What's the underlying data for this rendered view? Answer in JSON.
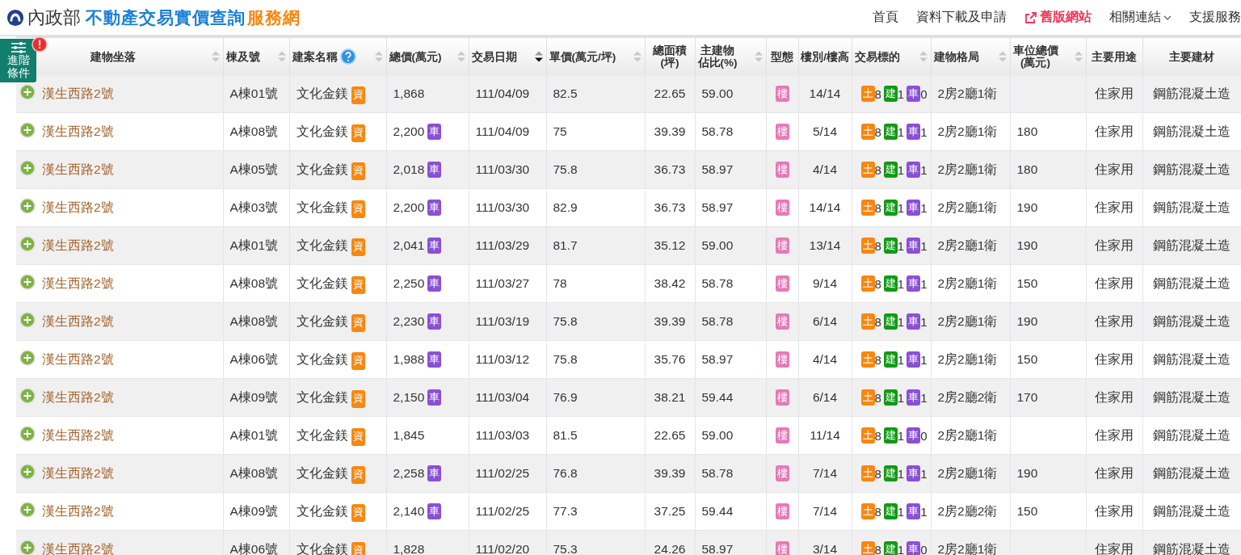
{
  "header": {
    "ministry": "內政部",
    "title": "不動產交易實價查詢",
    "title_accent": "服務網"
  },
  "nav": [
    {
      "label": "首頁",
      "kind": "link"
    },
    {
      "label": "資料下載及申請",
      "kind": "link"
    },
    {
      "label": "舊版網站",
      "kind": "external"
    },
    {
      "label": "相關連結",
      "kind": "dropdown"
    },
    {
      "label": "支援服務",
      "kind": "link"
    }
  ],
  "filter_tab": {
    "label": "進階條件",
    "alert": true
  },
  "table": {
    "columns": [
      {
        "lines": [
          "建物坐落"
        ],
        "sortable": true,
        "sorted": false
      },
      {
        "lines": [
          "棟及號"
        ],
        "sortable": true,
        "sorted": false
      },
      {
        "lines": [
          "建案名稱"
        ],
        "sortable": true,
        "sorted": false,
        "help": true
      },
      {
        "lines": [
          "總價(萬元)"
        ],
        "sortable": true,
        "sorted": false
      },
      {
        "lines": [
          "交易日期"
        ],
        "sortable": true,
        "sorted": true
      },
      {
        "lines": [
          "單價(萬元/坪)"
        ],
        "sortable": true,
        "sorted": false
      },
      {
        "lines": [
          "總面積",
          "(坪)"
        ],
        "sortable": false
      },
      {
        "lines": [
          "主建物",
          "佔比(%)"
        ],
        "sortable": true,
        "sorted": false
      },
      {
        "lines": [
          "型態"
        ],
        "sortable": false
      },
      {
        "lines": [
          "樓別/樓高"
        ],
        "sortable": false
      },
      {
        "lines": [
          "交易標的"
        ],
        "sortable": true,
        "sorted": false
      },
      {
        "lines": [
          "建物格局"
        ],
        "sortable": true,
        "sorted": false
      },
      {
        "lines": [
          "車位總價",
          "(萬元)"
        ],
        "sortable": true,
        "sorted": false
      },
      {
        "lines": [
          "主要用途"
        ],
        "sortable": false
      },
      {
        "lines": [
          "主要建材"
        ],
        "sortable": false
      }
    ],
    "rows": [
      {
        "address": "漢生西路2號",
        "unit": "A棟01號",
        "project": "文化金鎂",
        "project_badge": "資",
        "price": "1,868",
        "date": "111/04/09",
        "unit_price": "82.5",
        "area": "22.65",
        "ratio": "59.00",
        "type": "樓",
        "floor": "14/14",
        "targets": [
          {
            "label": "土",
            "count": "8",
            "color": "#f7870f"
          },
          {
            "label": "建",
            "count": "1",
            "color": "#119a14"
          },
          {
            "label": "車",
            "count": "0",
            "color": "#8b4fd6"
          }
        ],
        "layout": "2房2廳1衛",
        "use": "住家用",
        "material": "鋼筋混凝土造"
      },
      {
        "address": "漢生西路2號",
        "unit": "A棟08號",
        "project": "文化金鎂",
        "project_badge": "資",
        "price": "2,200",
        "price_badge": "車",
        "date": "111/04/09",
        "unit_price": "75",
        "area": "39.39",
        "ratio": "58.78",
        "type": "樓",
        "floor": "5/14",
        "targets": [
          {
            "label": "土",
            "count": "8",
            "color": "#f7870f"
          },
          {
            "label": "建",
            "count": "1",
            "color": "#119a14"
          },
          {
            "label": "車",
            "count": "1",
            "color": "#8b4fd6"
          }
        ],
        "layout": "2房2廳1衛",
        "parking_price": "180",
        "use": "住家用",
        "material": "鋼筋混凝土造"
      },
      {
        "address": "漢生西路2號",
        "unit": "A棟05號",
        "project": "文化金鎂",
        "project_badge": "資",
        "price": "2,018",
        "price_badge": "車",
        "date": "111/03/30",
        "unit_price": "75.8",
        "area": "36.73",
        "ratio": "58.97",
        "type": "樓",
        "floor": "4/14",
        "targets": [
          {
            "label": "土",
            "count": "8",
            "color": "#f7870f"
          },
          {
            "label": "建",
            "count": "1",
            "color": "#119a14"
          },
          {
            "label": "車",
            "count": "1",
            "color": "#8b4fd6"
          }
        ],
        "layout": "2房2廳1衛",
        "parking_price": "180",
        "use": "住家用",
        "material": "鋼筋混凝土造"
      },
      {
        "address": "漢生西路2號",
        "unit": "A棟03號",
        "project": "文化金鎂",
        "project_badge": "資",
        "price": "2,200",
        "price_badge": "車",
        "date": "111/03/30",
        "unit_price": "82.9",
        "area": "36.73",
        "ratio": "58.97",
        "type": "樓",
        "floor": "14/14",
        "targets": [
          {
            "label": "土",
            "count": "8",
            "color": "#f7870f"
          },
          {
            "label": "建",
            "count": "1",
            "color": "#119a14"
          },
          {
            "label": "車",
            "count": "1",
            "color": "#8b4fd6"
          }
        ],
        "layout": "2房2廳1衛",
        "parking_price": "190",
        "use": "住家用",
        "material": "鋼筋混凝土造"
      },
      {
        "address": "漢生西路2號",
        "unit": "A棟01號",
        "project": "文化金鎂",
        "project_badge": "資",
        "price": "2,041",
        "price_badge": "車",
        "date": "111/03/29",
        "unit_price": "81.7",
        "area": "35.12",
        "ratio": "59.00",
        "type": "樓",
        "floor": "13/14",
        "targets": [
          {
            "label": "土",
            "count": "8",
            "color": "#f7870f"
          },
          {
            "label": "建",
            "count": "1",
            "color": "#119a14"
          },
          {
            "label": "車",
            "count": "1",
            "color": "#8b4fd6"
          }
        ],
        "layout": "2房2廳1衛",
        "parking_price": "190",
        "use": "住家用",
        "material": "鋼筋混凝土造"
      },
      {
        "address": "漢生西路2號",
        "unit": "A棟08號",
        "project": "文化金鎂",
        "project_badge": "資",
        "price": "2,250",
        "price_badge": "車",
        "date": "111/03/27",
        "unit_price": "78",
        "area": "38.42",
        "ratio": "58.78",
        "type": "樓",
        "floor": "9/14",
        "targets": [
          {
            "label": "土",
            "count": "8",
            "color": "#f7870f"
          },
          {
            "label": "建",
            "count": "1",
            "color": "#119a14"
          },
          {
            "label": "車",
            "count": "1",
            "color": "#8b4fd6"
          }
        ],
        "layout": "2房2廳1衛",
        "parking_price": "150",
        "use": "住家用",
        "material": "鋼筋混凝土造"
      },
      {
        "address": "漢生西路2號",
        "unit": "A棟08號",
        "project": "文化金鎂",
        "project_badge": "資",
        "price": "2,230",
        "price_badge": "車",
        "date": "111/03/19",
        "unit_price": "75.8",
        "area": "39.39",
        "ratio": "58.78",
        "type": "樓",
        "floor": "6/14",
        "targets": [
          {
            "label": "土",
            "count": "8",
            "color": "#f7870f"
          },
          {
            "label": "建",
            "count": "1",
            "color": "#119a14"
          },
          {
            "label": "車",
            "count": "1",
            "color": "#8b4fd6"
          }
        ],
        "layout": "2房2廳1衛",
        "parking_price": "190",
        "use": "住家用",
        "material": "鋼筋混凝土造"
      },
      {
        "address": "漢生西路2號",
        "unit": "A棟06號",
        "project": "文化金鎂",
        "project_badge": "資",
        "price": "1,988",
        "price_badge": "車",
        "date": "111/03/12",
        "unit_price": "75.8",
        "area": "35.76",
        "ratio": "58.97",
        "type": "樓",
        "floor": "4/14",
        "targets": [
          {
            "label": "土",
            "count": "8",
            "color": "#f7870f"
          },
          {
            "label": "建",
            "count": "1",
            "color": "#119a14"
          },
          {
            "label": "車",
            "count": "1",
            "color": "#8b4fd6"
          }
        ],
        "layout": "2房2廳1衛",
        "parking_price": "150",
        "use": "住家用",
        "material": "鋼筋混凝土造"
      },
      {
        "address": "漢生西路2號",
        "unit": "A棟09號",
        "project": "文化金鎂",
        "project_badge": "資",
        "price": "2,150",
        "price_badge": "車",
        "date": "111/03/04",
        "unit_price": "76.9",
        "area": "38.21",
        "ratio": "59.44",
        "type": "樓",
        "floor": "6/14",
        "targets": [
          {
            "label": "土",
            "count": "8",
            "color": "#f7870f"
          },
          {
            "label": "建",
            "count": "1",
            "color": "#119a14"
          },
          {
            "label": "車",
            "count": "1",
            "color": "#8b4fd6"
          }
        ],
        "layout": "2房2廳2衛",
        "parking_price": "170",
        "use": "住家用",
        "material": "鋼筋混凝土造"
      },
      {
        "address": "漢生西路2號",
        "unit": "A棟01號",
        "project": "文化金鎂",
        "project_badge": "資",
        "price": "1,845",
        "date": "111/03/03",
        "unit_price": "81.5",
        "area": "22.65",
        "ratio": "59.00",
        "type": "樓",
        "floor": "11/14",
        "targets": [
          {
            "label": "土",
            "count": "8",
            "color": "#f7870f"
          },
          {
            "label": "建",
            "count": "1",
            "color": "#119a14"
          },
          {
            "label": "車",
            "count": "0",
            "color": "#8b4fd6"
          }
        ],
        "layout": "2房2廳1衛",
        "use": "住家用",
        "material": "鋼筋混凝土造"
      },
      {
        "address": "漢生西路2號",
        "unit": "A棟08號",
        "project": "文化金鎂",
        "project_badge": "資",
        "price": "2,258",
        "price_badge": "車",
        "date": "111/02/25",
        "unit_price": "76.8",
        "area": "39.39",
        "ratio": "58.78",
        "type": "樓",
        "floor": "7/14",
        "targets": [
          {
            "label": "土",
            "count": "8",
            "color": "#f7870f"
          },
          {
            "label": "建",
            "count": "1",
            "color": "#119a14"
          },
          {
            "label": "車",
            "count": "1",
            "color": "#8b4fd6"
          }
        ],
        "layout": "2房2廳1衛",
        "parking_price": "190",
        "use": "住家用",
        "material": "鋼筋混凝土造"
      },
      {
        "address": "漢生西路2號",
        "unit": "A棟09號",
        "project": "文化金鎂",
        "project_badge": "資",
        "price": "2,140",
        "price_badge": "車",
        "date": "111/02/25",
        "unit_price": "77.3",
        "area": "37.25",
        "ratio": "59.44",
        "type": "樓",
        "floor": "7/14",
        "targets": [
          {
            "label": "土",
            "count": "8",
            "color": "#f7870f"
          },
          {
            "label": "建",
            "count": "1",
            "color": "#119a14"
          },
          {
            "label": "車",
            "count": "1",
            "color": "#8b4fd6"
          }
        ],
        "layout": "2房2廳2衛",
        "parking_price": "150",
        "use": "住家用",
        "material": "鋼筋混凝土造"
      },
      {
        "address": "漢生西路2號",
        "unit": "A棟06號",
        "project": "文化金鎂",
        "project_badge": "資",
        "price": "1,828",
        "date": "111/02/20",
        "unit_price": "75.3",
        "area": "24.26",
        "ratio": "58.97",
        "type": "樓",
        "floor": "3/14",
        "targets": [
          {
            "label": "土",
            "count": "8",
            "color": "#f7870f"
          },
          {
            "label": "建",
            "count": "1",
            "color": "#119a14"
          },
          {
            "label": "車",
            "count": "0",
            "color": "#8b4fd6"
          }
        ],
        "layout": "2房2廳1衛",
        "use": "住家用",
        "material": "鋼筋混凝土造"
      }
    ]
  }
}
